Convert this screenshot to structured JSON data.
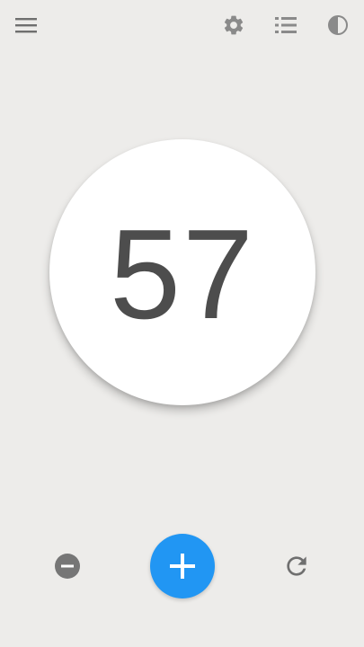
{
  "toolbar": {
    "icons": [
      "menu-icon",
      "gear-icon",
      "list-icon",
      "contrast-icon"
    ]
  },
  "counter": {
    "value": "57"
  },
  "controls": {
    "icons": [
      "minus-icon",
      "plus-icon",
      "refresh-icon"
    ]
  },
  "colors": {
    "background": "#edecea",
    "icon_gray": "#767676",
    "accent_blue": "#2196f3",
    "counter_text": "#4d4d4d",
    "circle": "#ffffff"
  }
}
